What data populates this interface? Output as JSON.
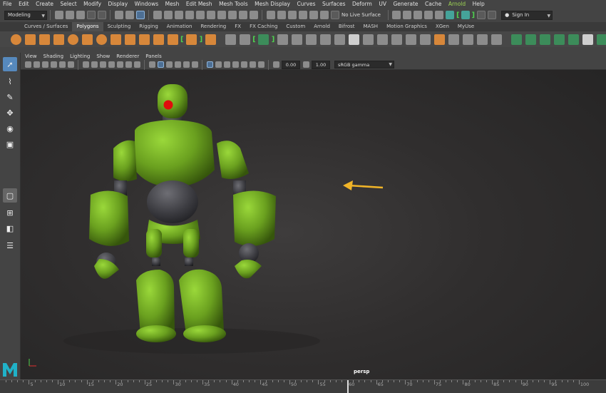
{
  "menubar": {
    "items": [
      "File",
      "Edit",
      "Create",
      "Select",
      "Modify",
      "Display",
      "Windows",
      "Mesh",
      "Edit Mesh",
      "Mesh Tools",
      "Mesh Display",
      "Curves",
      "Surfaces",
      "Deform",
      "UV",
      "Generate",
      "Cache",
      "Arnold",
      "Help"
    ],
    "highlighted": "Arnold"
  },
  "statusline": {
    "mode": "Modeling",
    "live_surface": "No Live Surface",
    "sign_in": "Sign In"
  },
  "shelf_tabs": {
    "items": [
      "Curves / Surfaces",
      "Polygons",
      "Sculpting",
      "Rigging",
      "Animation",
      "Rendering",
      "FX",
      "FX Caching",
      "Custom",
      "Arnold",
      "Bifrost",
      "MASH",
      "Motion Graphics",
      "XGen",
      "MyUse"
    ],
    "active": "Polygons",
    "bracketed": [
      "Bifrost",
      "MASH",
      "Motion Graphics"
    ]
  },
  "panel_menu": {
    "items": [
      "View",
      "Shading",
      "Lighting",
      "Show",
      "Renderer",
      "Panels"
    ]
  },
  "panel_toolbar": {
    "exposure": "0.00",
    "gamma": "1.00",
    "color_space": "sRGB gamma"
  },
  "viewport": {
    "camera": "persp",
    "model_color": "#6aa01f",
    "arrow_color": "#f0b428"
  },
  "timeline": {
    "labels": [
      "5",
      "10",
      "15",
      "20",
      "25",
      "30",
      "35",
      "40",
      "45",
      "50",
      "55",
      "60",
      "65",
      "70",
      "75",
      "80",
      "85",
      "90",
      "95",
      "100"
    ]
  },
  "logo_letter": "M"
}
